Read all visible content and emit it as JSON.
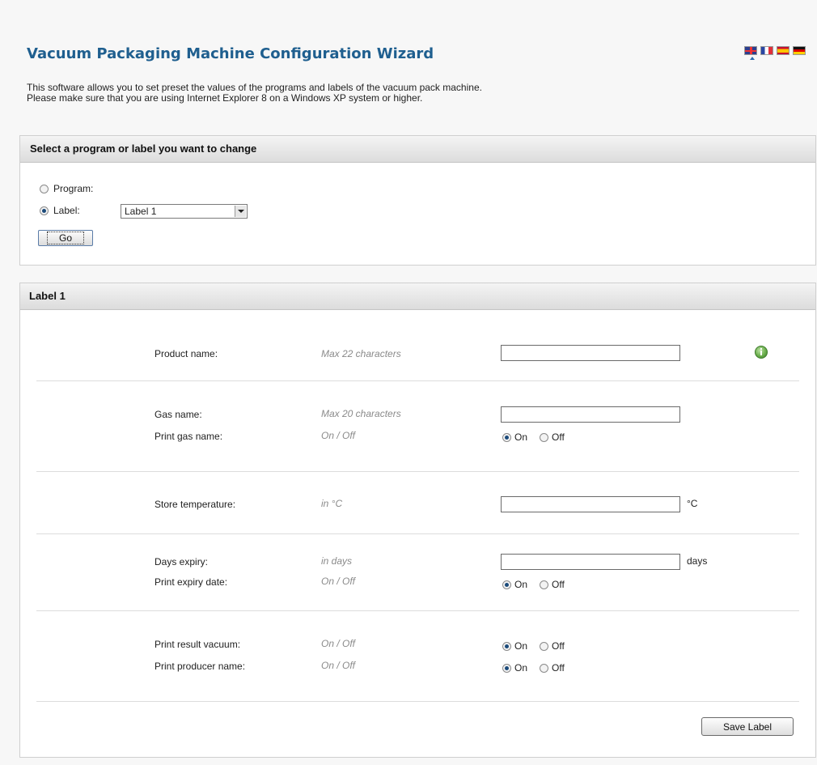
{
  "header": {
    "title": "Vacuum Packaging Machine Configuration Wizard",
    "intro_line1": "This software allows you to set preset the values of the programs and labels of the vacuum pack machine.",
    "intro_line2": "Please make sure that you are using Internet Explorer 8 on a Windows XP system or higher.",
    "languages": [
      "uk-flag-icon",
      "fr-flag-icon",
      "es-flag-icon",
      "de-flag-icon"
    ]
  },
  "selector": {
    "heading": "Select a program or label you want to change",
    "program_label": "Program:",
    "label_label": "Label:",
    "selected_type": "label",
    "label_value": "Label 1",
    "go_label": "Go"
  },
  "label_form": {
    "heading": "Label 1",
    "product_name": {
      "label": "Product name:",
      "hint": "Max 22 characters",
      "value": ""
    },
    "gas_name": {
      "label": "Gas name:",
      "hint": "Max 20 characters",
      "value": ""
    },
    "print_gas_name": {
      "label": "Print gas name:",
      "hint": "On / Off",
      "value": "On"
    },
    "store_temperature": {
      "label": "Store temperature:",
      "hint": "in °C",
      "value": "",
      "unit": "°C"
    },
    "days_expiry": {
      "label": "Days expiry:",
      "hint": "in days",
      "value": "",
      "unit": "days"
    },
    "print_expiry_date": {
      "label": "Print expiry date:",
      "hint": "On / Off",
      "value": "On"
    },
    "print_result_vacuum": {
      "label": "Print result vacuum:",
      "hint": "On / Off",
      "value": "On"
    },
    "print_producer_name": {
      "label": "Print producer name:",
      "hint": "On / Off",
      "value": "On"
    },
    "on_label": "On",
    "off_label": "Off",
    "save_label": "Save Label"
  },
  "colors": {
    "title": "#1f5f8f",
    "hint": "#8a8a8a",
    "info_icon": "#6aae4c"
  }
}
